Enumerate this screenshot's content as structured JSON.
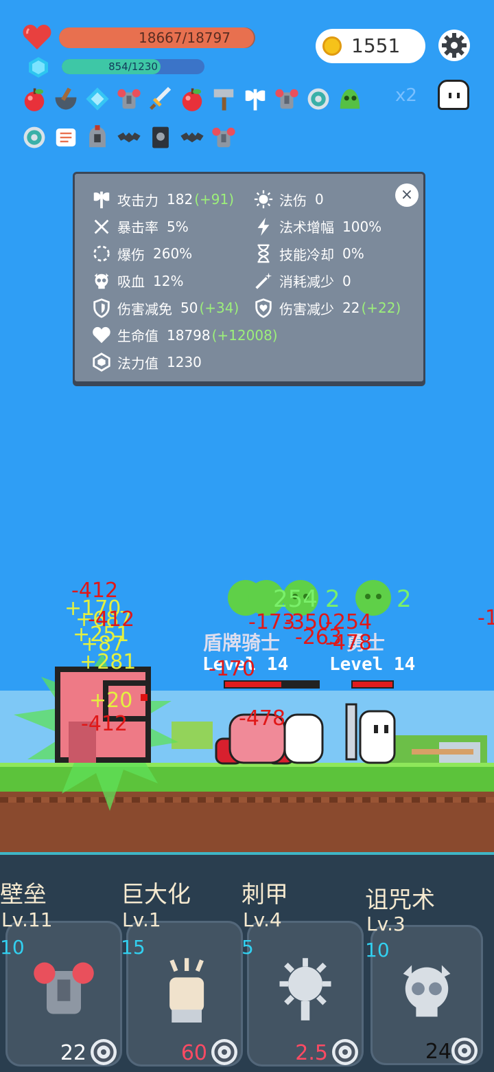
{
  "hud": {
    "hp_text": "18667/18797",
    "hp_ratio": 0.993,
    "mp_text": "854/1230",
    "mp_ratio": 0.694,
    "coins": "1551",
    "item_multiplier": "x2",
    "items_row1": [
      "apple-icon",
      "mortar-icon",
      "diamond-icon",
      "armor-icon",
      "sword-icon",
      "apple-icon",
      "hammer-icon",
      "axe-icon",
      "armor-icon",
      "shield-ring-icon",
      "slime-icon"
    ],
    "items_row2": [
      "shield-ring-icon",
      "scroll-icon",
      "helmet-icon",
      "bat-icon",
      "book-icon",
      "bat-icon",
      "armor-icon"
    ]
  },
  "stats": {
    "left": [
      {
        "icon": "axe-icon",
        "label": "攻击力",
        "value": "182",
        "bonus": "(+91)"
      },
      {
        "icon": "crit-icon",
        "label": "暴击率",
        "value": "5%",
        "bonus": ""
      },
      {
        "icon": "burst-icon",
        "label": "爆伤",
        "value": "260%",
        "bonus": ""
      },
      {
        "icon": "skull-icon",
        "label": "吸血",
        "value": "12%",
        "bonus": ""
      },
      {
        "icon": "shield-icon",
        "label": "伤害减免",
        "value": "50",
        "bonus": "(+34)"
      },
      {
        "icon": "heart-icon",
        "label": "生命值",
        "value": "18798",
        "bonus": "(+12008)"
      },
      {
        "icon": "hex-icon",
        "label": "法力值",
        "value": "1230",
        "bonus": ""
      }
    ],
    "right": [
      {
        "icon": "sun-icon",
        "label": "法伤",
        "value": "0",
        "bonus": ""
      },
      {
        "icon": "lightning-icon",
        "label": "法术增幅",
        "value": "100%",
        "bonus": ""
      },
      {
        "icon": "hourglass-icon",
        "label": "技能冷却",
        "value": "0%",
        "bonus": ""
      },
      {
        "icon": "wand-icon",
        "label": "消耗减少",
        "value": "0",
        "bonus": ""
      },
      {
        "icon": "shield-heart-icon",
        "label": "伤害减少",
        "value": "22",
        "bonus": "(+22)"
      }
    ],
    "close_label": "×"
  },
  "battle": {
    "floating_texts": [
      {
        "text": "-412",
        "cls": "red"
      },
      {
        "text": "+170",
        "cls": "yel"
      },
      {
        "text": "+687",
        "cls": "yel"
      },
      {
        "text": "-412",
        "cls": "red"
      },
      {
        "text": "+251",
        "cls": "yel"
      },
      {
        "text": "+87",
        "cls": "yel"
      },
      {
        "text": "+281",
        "cls": "yel"
      },
      {
        "text": "+20",
        "cls": "yel"
      },
      {
        "text": "-412",
        "cls": "red"
      },
      {
        "text": "254",
        "cls": "grn"
      },
      {
        "text": "2",
        "cls": "grn"
      },
      {
        "text": "2",
        "cls": "grn"
      },
      {
        "text": "-173",
        "cls": "red"
      },
      {
        "text": "-350",
        "cls": "red"
      },
      {
        "text": "-254",
        "cls": "red"
      },
      {
        "text": "-263",
        "cls": "red"
      },
      {
        "text": "-478",
        "cls": "red"
      },
      {
        "text": "-170",
        "cls": "red"
      },
      {
        "text": "-478",
        "cls": "red"
      },
      {
        "text": "-1",
        "cls": "red"
      }
    ],
    "enemy_names": [
      "盾牌骑士",
      "勇士"
    ],
    "enemy_levels": [
      "Level 14",
      "Level 14"
    ],
    "enemy_hp": [
      0.6,
      1.0
    ]
  },
  "skills": [
    {
      "name": "壁垒",
      "level": "Lv.11",
      "cost": "10",
      "value": "22",
      "value_color": "#ffffff",
      "icon": "armor-icon"
    },
    {
      "name": "巨大化",
      "level": "Lv.1",
      "cost": "15",
      "value": "60",
      "value_color": "#ff4a63",
      "icon": "fist-icon"
    },
    {
      "name": "刺甲",
      "level": "Lv.4",
      "cost": "5",
      "value": "2.5",
      "value_color": "#ff4a63",
      "icon": "spike-ball-icon"
    },
    {
      "name": "诅咒术",
      "level": "Lv.3",
      "cost": "10",
      "value": "24",
      "value_color": "#111111",
      "icon": "skull-icon"
    }
  ]
}
